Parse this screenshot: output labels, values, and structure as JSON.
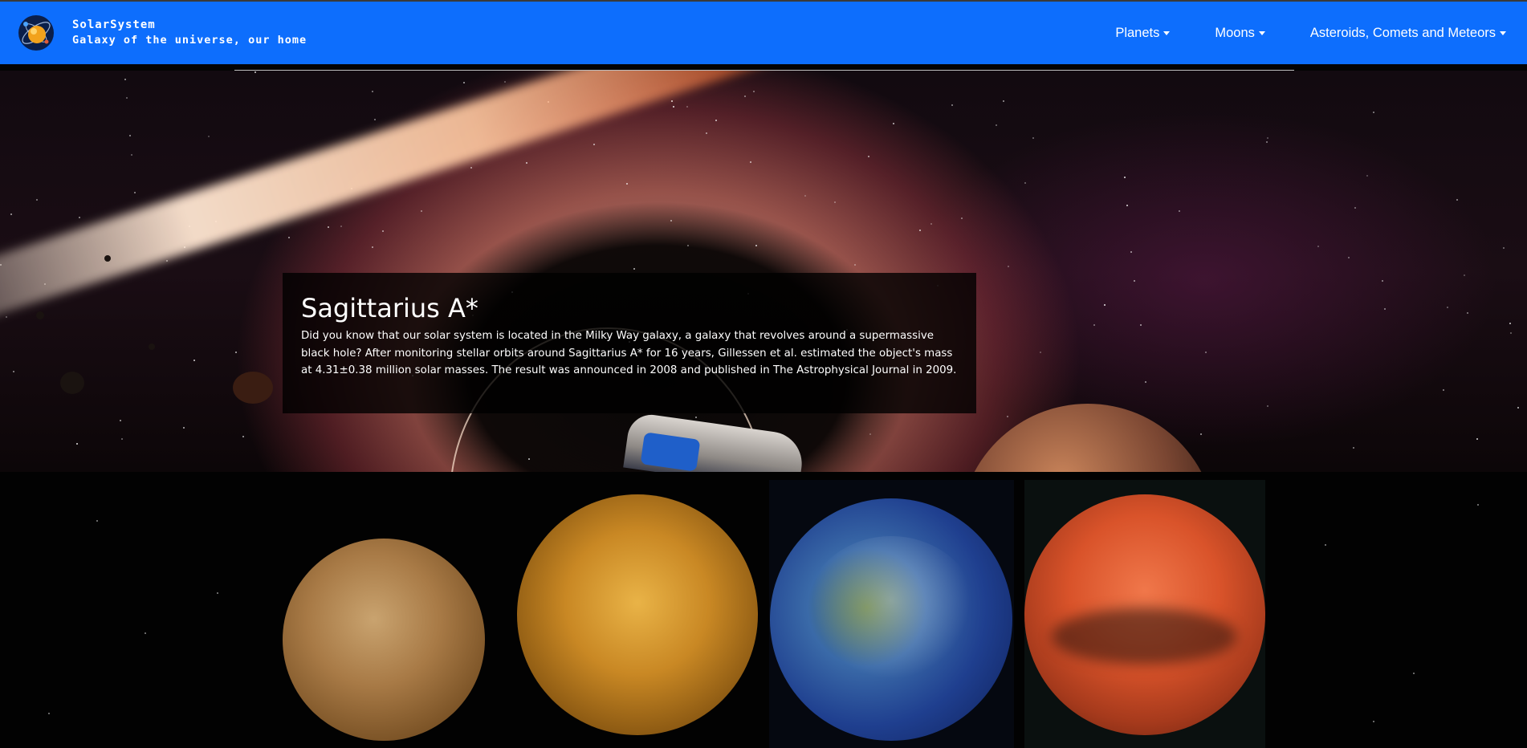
{
  "navbar": {
    "brand_title": "SolarSystem",
    "brand_subtitle": "Galaxy of the universe, our home",
    "logo_icon": "solar-system-logo-icon",
    "links": [
      {
        "label": "Planets"
      },
      {
        "label": "Moons"
      },
      {
        "label": "Asteroids, Comets and Meteors"
      }
    ],
    "color": "#0d6efd"
  },
  "hero": {
    "title": "Sagittarius A*",
    "text": "Did you know that our solar system is located in the Milky Way galaxy, a galaxy that revolves around a supermassive black hole? After monitoring stellar orbits around Sagittarius A* for 16 years, Gillessen et al. estimated the object's mass at 4.31±0.38 million solar masses. The result was announced in 2008 and published in The Astrophysical Journal in 2009."
  },
  "planets": [
    "Mercury",
    "Venus",
    "Earth",
    "Mars"
  ]
}
